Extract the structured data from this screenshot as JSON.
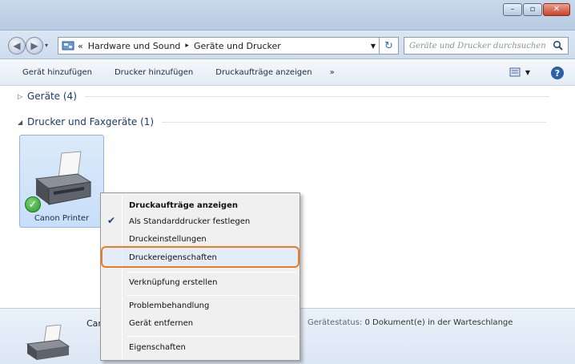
{
  "window": {
    "buttons": {
      "minimize": "–",
      "maximize": "▫",
      "close": "✕"
    }
  },
  "address_bar": {
    "prefix": "«",
    "crumbs": [
      "Hardware und Sound",
      "Geräte und Drucker"
    ],
    "separator": "▸",
    "search_placeholder": "Geräte und Drucker durchsuchen"
  },
  "toolbar": {
    "items": [
      "Gerät hinzufügen",
      "Drucker hinzufügen",
      "Druckaufträge anzeigen"
    ],
    "more": "»",
    "help": "?"
  },
  "groups": [
    {
      "label": "Geräte (4)",
      "expanded": false
    },
    {
      "label": "Drucker und Faxgeräte (1)",
      "expanded": true
    }
  ],
  "device": {
    "name": "Canon Printer",
    "default": true
  },
  "context_menu": {
    "items": [
      {
        "label": "Druckaufträge anzeigen",
        "bold": true
      },
      {
        "label": "Als Standarddrucker festlegen",
        "checked": true
      },
      {
        "label": "Druckeinstellungen"
      },
      {
        "label": "Druckereigenschaften",
        "highlighted": true
      },
      {
        "label": "Verknüpfung erstellen"
      },
      {
        "label": "Problembehandlung"
      },
      {
        "label": "Gerät entfernen"
      },
      {
        "label": "Eigenschaften"
      }
    ]
  },
  "details": {
    "name_partial": "Car",
    "status_label": "Gerätestatus:",
    "status_value": "0 Dokument(e) in der Warteschlange"
  },
  "colors": {
    "highlight_border": "#ee7a22",
    "selection_bg": "#c8defa",
    "link_text": "#1e3a66"
  }
}
